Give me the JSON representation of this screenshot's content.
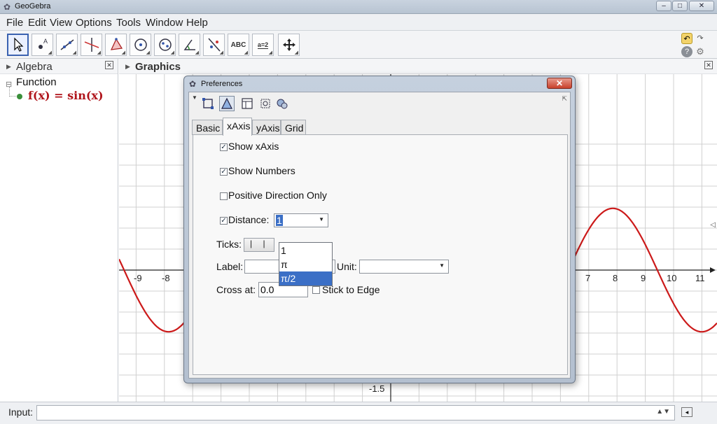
{
  "window": {
    "title": "GeoGebra",
    "controls": [
      "–",
      "□",
      "✕"
    ]
  },
  "menu": [
    "File",
    "Edit",
    "View",
    "Options",
    "Tools",
    "Window",
    "Help"
  ],
  "toolbar": {
    "text_tool_label": "ABC",
    "slider_tool_label": "a=2"
  },
  "algebra": {
    "title": "Algebra",
    "group": "Function",
    "function": "f(x) = sin(x)"
  },
  "graphics": {
    "title": "Graphics",
    "x_tick_labels_left": [
      "-9",
      "-8"
    ],
    "x_tick_labels_right": [
      "7",
      "8",
      "9",
      "10",
      "11"
    ],
    "y_tick_label": "-1.5",
    "curve_color": "#cc1a1a"
  },
  "input": {
    "label": "Input:",
    "value": ""
  },
  "dialog": {
    "title": "Preferences",
    "tabs": [
      "Basic",
      "xAxis",
      "yAxis",
      "Grid"
    ],
    "active_tab": "xAxis",
    "show_xaxis": {
      "label": "Show xAxis",
      "checked": true
    },
    "show_numbers": {
      "label": "Show Numbers",
      "checked": true
    },
    "positive_only": {
      "label": "Positive Direction Only",
      "checked": false
    },
    "distance": {
      "label": "Distance:",
      "checked": true,
      "value": "1",
      "options": [
        "1",
        "π",
        "π/2"
      ],
      "highlighted": "π/2"
    },
    "ticks": {
      "label": "Ticks:",
      "value": "|  |"
    },
    "label_field": {
      "label": "Label:",
      "value": ""
    },
    "unit_field": {
      "label": "Unit:",
      "value": ""
    },
    "cross_at": {
      "label": "Cross at:",
      "value": "0.0"
    },
    "stick_to_edge": {
      "label": "Stick to Edge",
      "checked": false
    }
  }
}
